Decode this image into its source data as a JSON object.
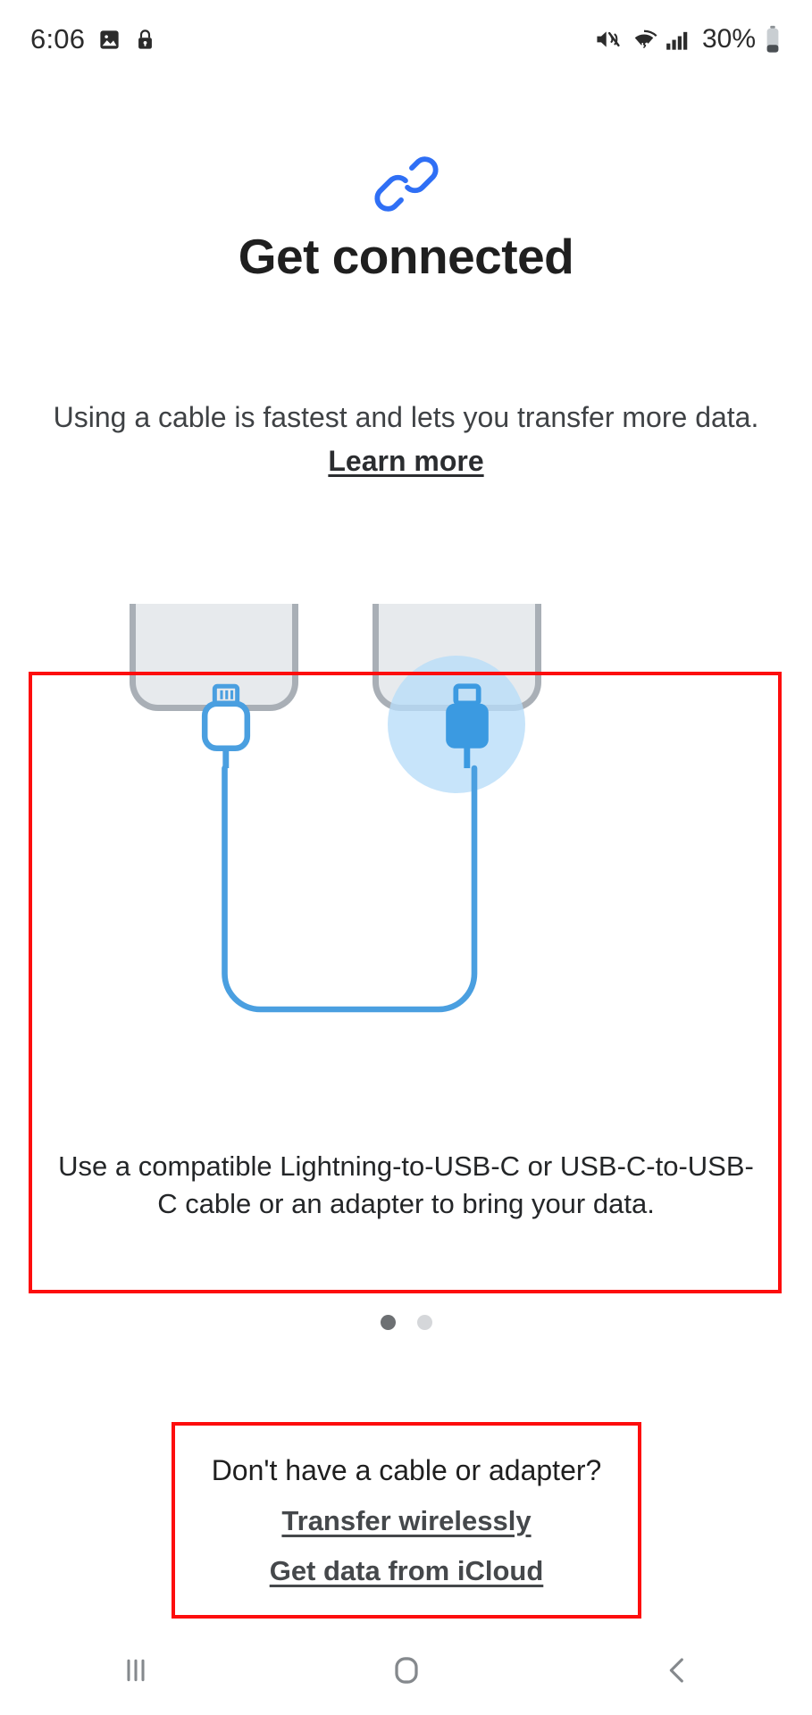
{
  "status_bar": {
    "time": "6:06",
    "battery_percent": "30%",
    "icons": [
      "image-icon",
      "lock-icon",
      "mute-icon",
      "wifi-icon",
      "cellular-signal-icon",
      "battery-icon"
    ]
  },
  "header": {
    "icon": "link-icon",
    "icon_color": "#2f6ff5",
    "title": "Get connected",
    "subtitle_text": "Using a cable is fastest and lets you transfer more data. ",
    "subtitle_link": "Learn more"
  },
  "card": {
    "illustration": {
      "name": "cable-connection-illustration",
      "left_connector": "lightning-connector-icon",
      "right_connector": "usb-c-connector-icon",
      "cable_color": "#4a9fe0",
      "phone_body_color": "#e7eaed",
      "phone_border_color": "#a9afb6",
      "glow_color": "#b7dcf8"
    },
    "caption": "Use a compatible Lightning-to-USB-C or USB-C-to-USB-C cable or an adapter to bring your data."
  },
  "pager": {
    "dots": [
      {
        "state": "active"
      },
      {
        "state": "inactive"
      }
    ],
    "active_color": "#6d7073",
    "inactive_color": "#d5d7da"
  },
  "bottom": {
    "question": "Don't have a cable or adapter?",
    "link_wireless": "Transfer wirelessly",
    "link_icloud": "Get data from iCloud"
  },
  "nav_bar": {
    "recents": "recents-icon",
    "home": "home-icon",
    "back": "back-icon"
  },
  "annotations": {
    "box_color": "#fd0d0d",
    "card_box": "illustration-card-highlight",
    "links_box": "bottom-links-highlight"
  }
}
